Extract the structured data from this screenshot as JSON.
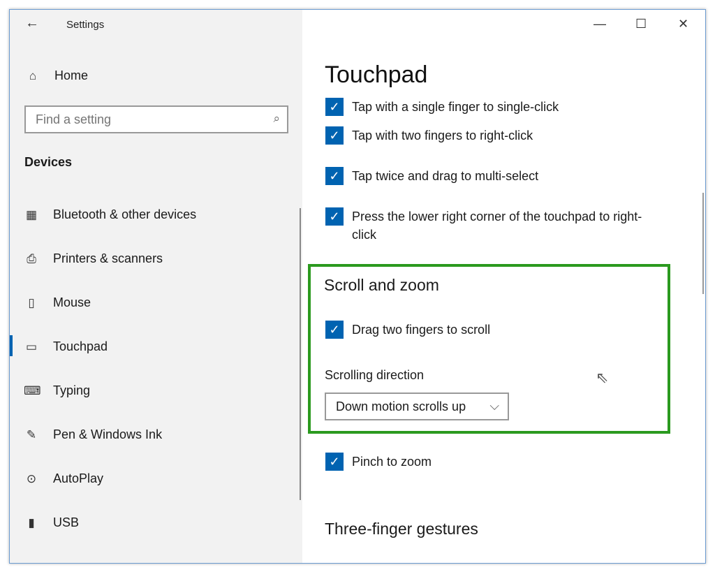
{
  "window": {
    "title": "Settings",
    "back_icon": "arrow-left-icon",
    "controls": [
      "minimize",
      "maximize",
      "close"
    ]
  },
  "sidebar": {
    "home": "Home",
    "search_placeholder": "Find a setting",
    "section": "Devices",
    "items": [
      {
        "label": "Bluetooth & other devices",
        "icon": "bluetooth-devices-icon",
        "glyph": "▦"
      },
      {
        "label": "Printers & scanners",
        "icon": "printer-icon",
        "glyph": "⎙"
      },
      {
        "label": "Mouse",
        "icon": "mouse-icon",
        "glyph": "▯"
      },
      {
        "label": "Touchpad",
        "icon": "touchpad-icon",
        "glyph": "▭",
        "selected": true
      },
      {
        "label": "Typing",
        "icon": "keyboard-icon",
        "glyph": "⌨"
      },
      {
        "label": "Pen & Windows Ink",
        "icon": "pen-icon",
        "glyph": "✎"
      },
      {
        "label": "AutoPlay",
        "icon": "autoplay-icon",
        "glyph": "⊙"
      },
      {
        "label": "USB",
        "icon": "usb-icon",
        "glyph": "▮"
      }
    ]
  },
  "main": {
    "title": "Touchpad",
    "taps": [
      "Tap with a single finger to single-click",
      "Tap with two fingers to right-click",
      "Tap twice and drag to multi-select",
      "Press the lower right corner of the touchpad to right-click"
    ],
    "scroll": {
      "heading": "Scroll and zoom",
      "drag": "Drag two fingers to scroll",
      "direction_label": "Scrolling direction",
      "direction_value": "Down motion scrolls up",
      "pinch": "Pinch to zoom"
    },
    "three_finger": "Three-finger gestures"
  },
  "colors": {
    "accent": "#0063b1",
    "highlight": "#2b9a1f"
  }
}
